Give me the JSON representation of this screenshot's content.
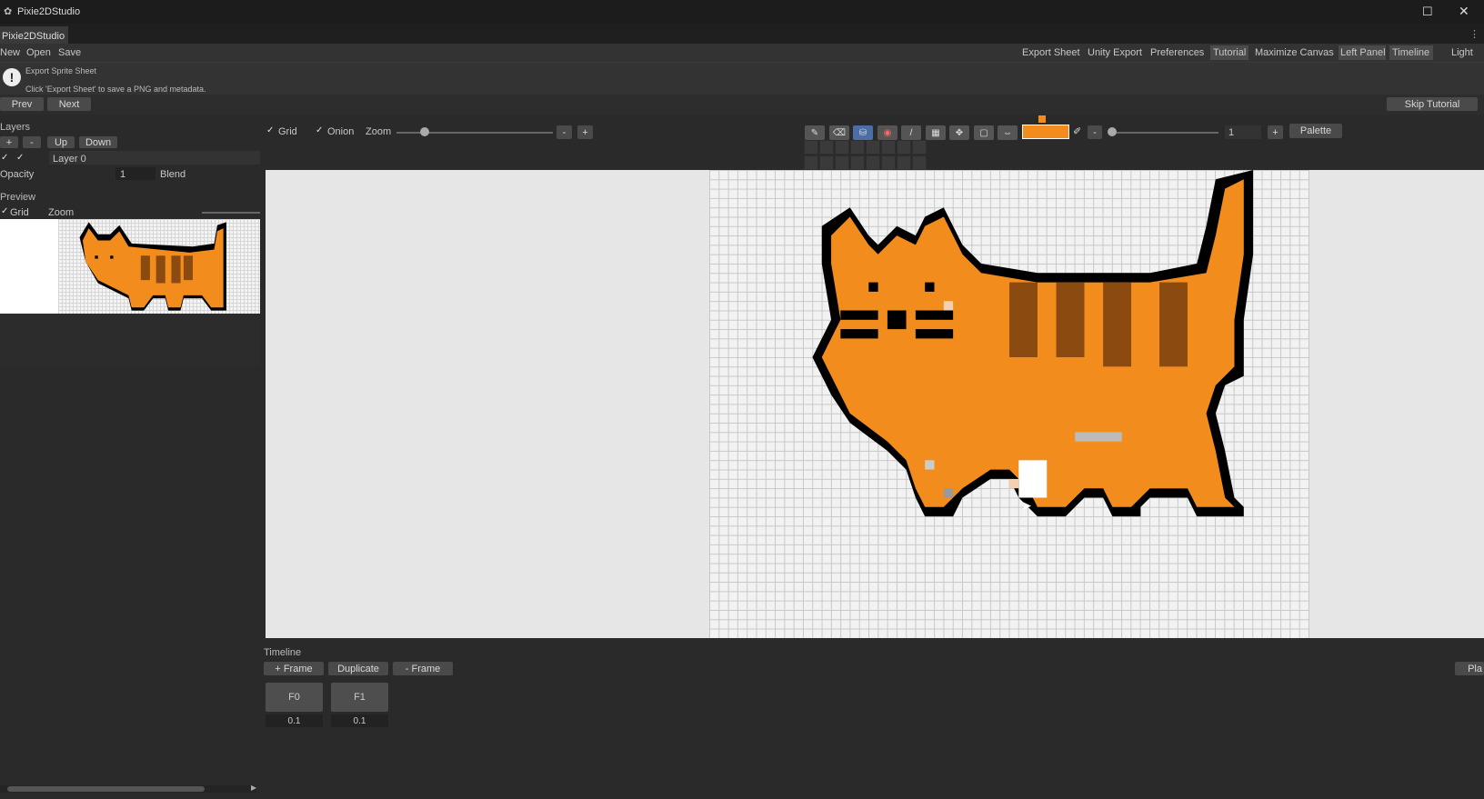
{
  "window": {
    "title": "Pixie2DStudio",
    "tab": "Pixie2DStudio"
  },
  "menu": {
    "new": "New",
    "open": "Open",
    "save": "Save",
    "right": [
      "Export Sheet",
      "Unity Export",
      "Preferences",
      "Tutorial",
      "Maximize Canvas",
      "Left Panel",
      "Timeline",
      "Light"
    ]
  },
  "notice": {
    "title": "Export Sprite Sheet",
    "body": "Click 'Export Sheet' to save a PNG and metadata."
  },
  "tutorial": {
    "prev": "Prev",
    "next": "Next",
    "skip": "Skip Tutorial"
  },
  "layers": {
    "heading": "Layers",
    "add": "+",
    "remove": "-",
    "up": "Up",
    "down": "Down",
    "layer_name": "Layer 0",
    "opacity_label": "Opacity",
    "opacity_value": "1",
    "blend_label": "Blend"
  },
  "preview": {
    "heading": "Preview",
    "grid": "Grid",
    "zoom": "Zoom"
  },
  "toolbar": {
    "grid": "Grid",
    "onion": "Onion",
    "zoom": "Zoom",
    "zoom_out": "-",
    "zoom_in": "+",
    "brush_minus": "-",
    "brush_value": "1",
    "brush_plus": "+",
    "palette": "Palette"
  },
  "timeline": {
    "heading": "Timeline",
    "add_frame": "+ Frame",
    "duplicate": "Duplicate",
    "remove_frame": "- Frame",
    "frames": [
      {
        "label": "F0",
        "duration": "0.1"
      },
      {
        "label": "F1",
        "duration": "0.1"
      }
    ],
    "play_partial": "Pla"
  },
  "colors": {
    "accent": "#f28c1c",
    "stripe": "#8a4a10",
    "outline": "#000000",
    "selected_tool": "#4b6ea8"
  },
  "icons": [
    "pencil-icon",
    "eraser-icon",
    "fill-bucket-icon",
    "eyedropper-icon",
    "line-icon",
    "rect-icon",
    "move-icon",
    "select-icon",
    "mirror-icon"
  ]
}
